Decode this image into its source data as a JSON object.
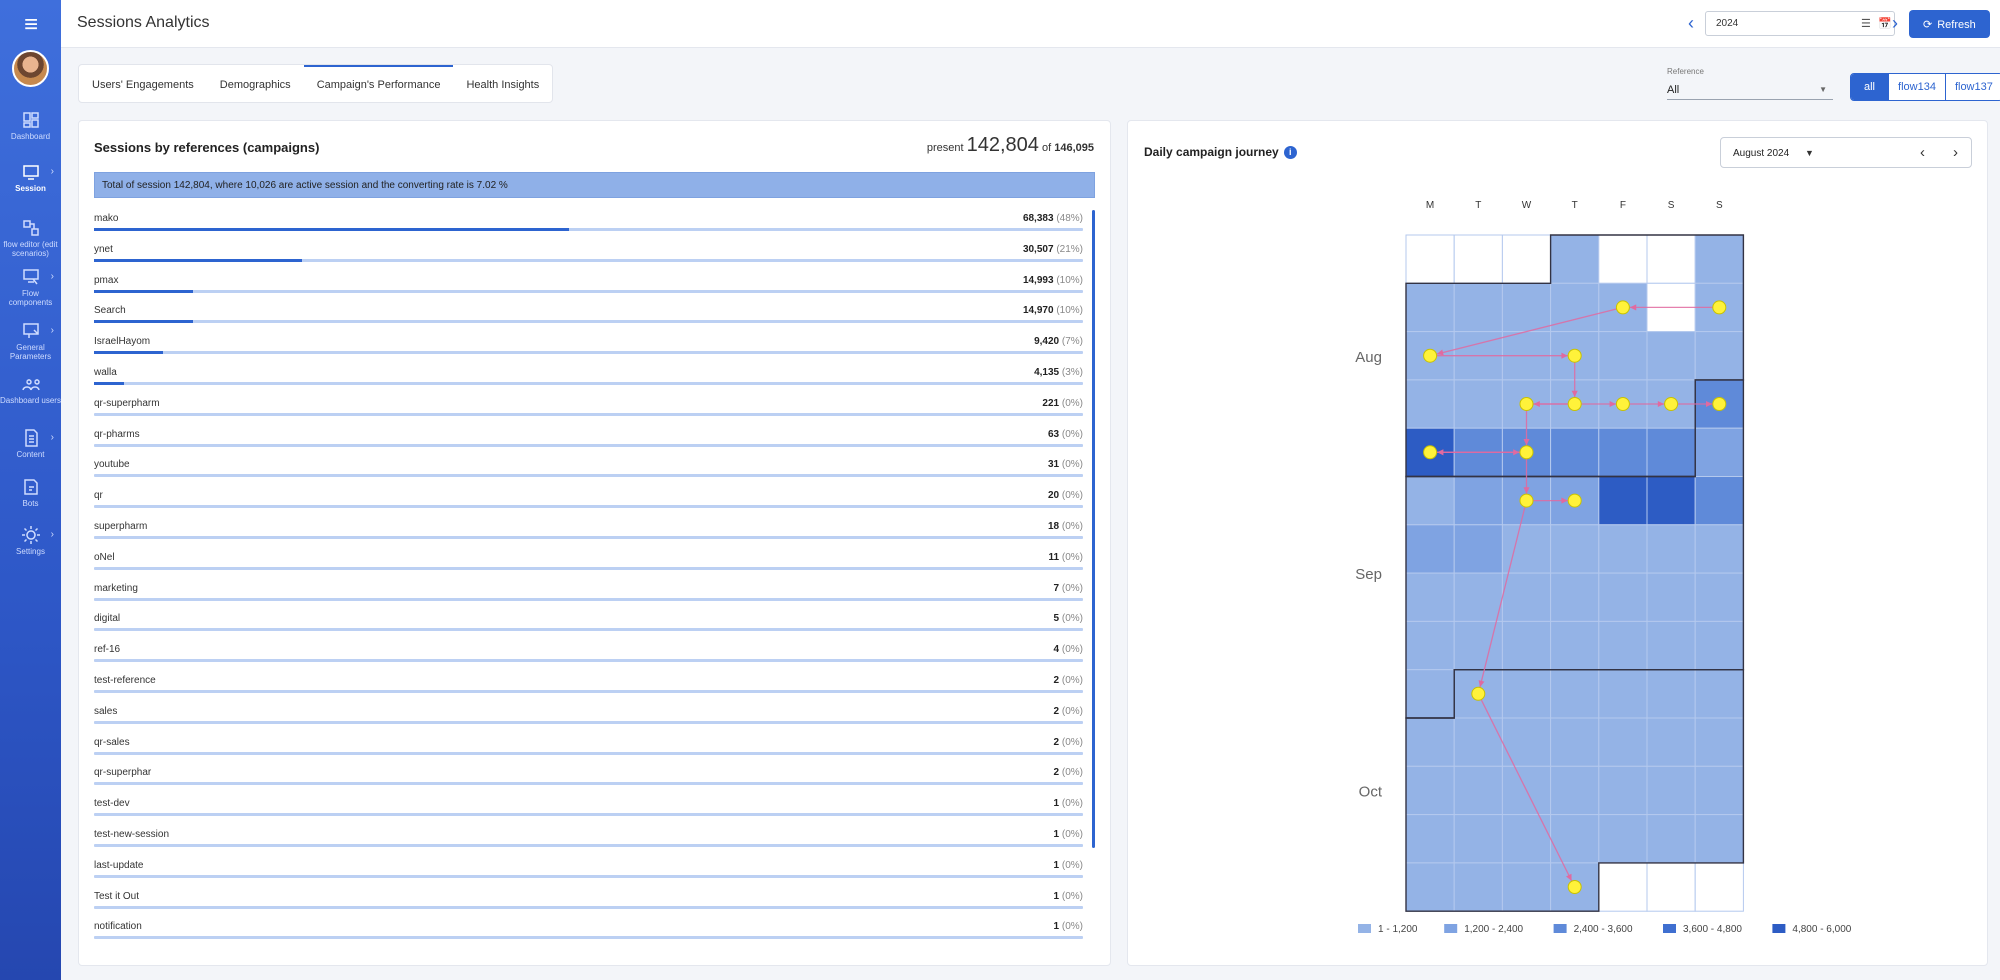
{
  "app": {
    "title": "Sessions Analytics"
  },
  "sidebar": {
    "items": [
      {
        "label": "Dashboard",
        "icon": "dashboard-icon",
        "chevron": false,
        "active": false
      },
      {
        "label": "Session",
        "icon": "session-icon",
        "chevron": true,
        "active": true
      },
      {
        "label": "flow editor (edit scenarios)",
        "icon": "flow-editor-icon",
        "chevron": false,
        "active": false
      },
      {
        "label": "Flow components",
        "icon": "flow-components-icon",
        "chevron": true,
        "active": false
      },
      {
        "label": "General Parameters",
        "icon": "parameters-icon",
        "chevron": true,
        "active": false
      },
      {
        "label": "Dashboard users",
        "icon": "users-icon",
        "chevron": false,
        "active": false
      },
      {
        "label": "Content",
        "icon": "content-icon",
        "chevron": true,
        "active": false
      },
      {
        "label": "Bots",
        "icon": "bots-icon",
        "chevron": false,
        "active": false
      },
      {
        "label": "Settings",
        "icon": "settings-icon",
        "chevron": true,
        "active": false
      }
    ]
  },
  "header": {
    "year": "2024",
    "refresh_label": "Refresh"
  },
  "tabs": [
    {
      "label": "Users' Engagements",
      "active": false
    },
    {
      "label": "Demographics",
      "active": false
    },
    {
      "label": "Campaign's Performance",
      "active": true
    },
    {
      "label": "Health Insights",
      "active": false
    }
  ],
  "filters": {
    "reference_label": "Reference",
    "reference_value": "All",
    "flows": [
      {
        "label": "all",
        "active": true
      },
      {
        "label": "flow134",
        "active": false
      },
      {
        "label": "flow137",
        "active": false
      }
    ]
  },
  "sessions": {
    "title": "Sessions by references (campaigns)",
    "present_label": "present",
    "present": "142,804",
    "of_label": "of",
    "total": "146,095",
    "banner": "Total of session 142,804, where 10,026 are active session and the converting rate is 7.02 %",
    "rows": [
      {
        "name": "mako",
        "value": "68,383",
        "pct": "(48%)",
        "share": 0.48
      },
      {
        "name": "ynet",
        "value": "30,507",
        "pct": "(21%)",
        "share": 0.21
      },
      {
        "name": "pmax",
        "value": "14,993",
        "pct": "(10%)",
        "share": 0.1
      },
      {
        "name": "Search",
        "value": "14,970",
        "pct": "(10%)",
        "share": 0.1
      },
      {
        "name": "IsraelHayom",
        "value": "9,420",
        "pct": "(7%)",
        "share": 0.07
      },
      {
        "name": "walla",
        "value": "4,135",
        "pct": "(3%)",
        "share": 0.03
      },
      {
        "name": "qr-superpharm",
        "value": "221",
        "pct": "(0%)",
        "share": 0
      },
      {
        "name": "qr-pharms",
        "value": "63",
        "pct": "(0%)",
        "share": 0
      },
      {
        "name": "youtube",
        "value": "31",
        "pct": "(0%)",
        "share": 0
      },
      {
        "name": "qr",
        "value": "20",
        "pct": "(0%)",
        "share": 0
      },
      {
        "name": "superpharm",
        "value": "18",
        "pct": "(0%)",
        "share": 0
      },
      {
        "name": "oNel",
        "value": "11",
        "pct": "(0%)",
        "share": 0
      },
      {
        "name": "marketing",
        "value": "7",
        "pct": "(0%)",
        "share": 0
      },
      {
        "name": "digital",
        "value": "5",
        "pct": "(0%)",
        "share": 0
      },
      {
        "name": "ref-16",
        "value": "4",
        "pct": "(0%)",
        "share": 0
      },
      {
        "name": "test-reference",
        "value": "2",
        "pct": "(0%)",
        "share": 0
      },
      {
        "name": "sales",
        "value": "2",
        "pct": "(0%)",
        "share": 0
      },
      {
        "name": "qr-sales",
        "value": "2",
        "pct": "(0%)",
        "share": 0
      },
      {
        "name": "qr-superphar",
        "value": "2",
        "pct": "(0%)",
        "share": 0
      },
      {
        "name": "test-dev",
        "value": "1",
        "pct": "(0%)",
        "share": 0
      },
      {
        "name": "test-new-session",
        "value": "1",
        "pct": "(0%)",
        "share": 0
      },
      {
        "name": "last-update",
        "value": "1",
        "pct": "(0%)",
        "share": 0
      },
      {
        "name": "Test it Out",
        "value": "1",
        "pct": "(0%)",
        "share": 0
      },
      {
        "name": "notification",
        "value": "1",
        "pct": "(0%)",
        "share": 0
      }
    ]
  },
  "calendar": {
    "title": "Daily campaign journey",
    "month": "August 2024",
    "weekdays": [
      "M",
      "T",
      "W",
      "T",
      "F",
      "S",
      "S"
    ],
    "months": [
      "Aug",
      "Sep",
      "Oct"
    ],
    "legend": [
      "1 - 1,200",
      "1,200 - 2,400",
      "2,400 - 3,600",
      "3,600 - 4,800",
      "4,800 - 6,000"
    ],
    "colors": [
      "#94b3e6",
      "#7fa3e2",
      "#5f8ad9",
      "#3f6fd0",
      "#2d5cc4"
    ],
    "empty_color": "#ffffff",
    "cell_levels": [
      [
        null,
        null,
        null,
        1,
        null,
        null,
        1
      ],
      [
        1,
        1,
        1,
        1,
        1,
        null,
        1
      ],
      [
        1,
        1,
        1,
        1,
        1,
        1,
        1
      ],
      [
        1,
        1,
        1,
        1,
        1,
        1,
        3
      ],
      [
        5,
        3,
        3,
        3,
        3,
        3,
        2
      ],
      [
        1,
        2,
        2,
        2,
        5,
        5,
        3
      ],
      [
        2,
        2,
        1,
        1,
        1,
        1,
        1
      ],
      [
        1,
        1,
        1,
        1,
        1,
        1,
        1
      ],
      [
        1,
        1,
        1,
        1,
        1,
        1,
        1
      ],
      [
        1,
        1,
        1,
        1,
        1,
        1,
        1
      ],
      [
        1,
        1,
        1,
        1,
        1,
        1,
        1
      ],
      [
        1,
        1,
        1,
        1,
        1,
        1,
        1
      ],
      [
        1,
        1,
        1,
        1,
        1,
        1,
        1
      ],
      [
        1,
        1,
        1,
        1,
        null,
        null,
        null
      ]
    ],
    "journey": [
      [
        1,
        6
      ],
      [
        2,
        0
      ],
      [
        2,
        3
      ],
      [
        3,
        2
      ],
      [
        3,
        3
      ],
      [
        3,
        4
      ],
      [
        3,
        5
      ],
      [
        3,
        6
      ],
      [
        4,
        0
      ],
      [
        4,
        2
      ],
      [
        5,
        2
      ],
      [
        5,
        3
      ],
      [
        9,
        1
      ],
      [
        13,
        3
      ],
      [
        1,
        4
      ]
    ]
  }
}
